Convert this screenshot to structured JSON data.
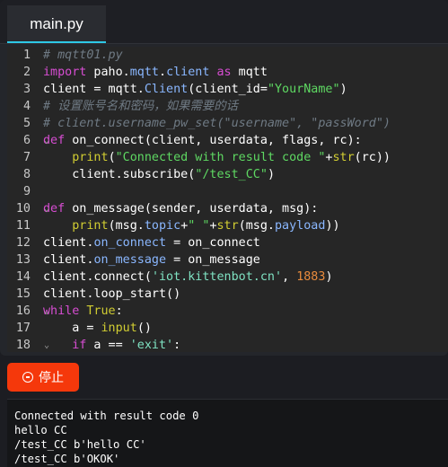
{
  "tab": {
    "label": "main.py"
  },
  "code_lines": [
    {
      "n": "1",
      "fold": "",
      "tokens": [
        [
          "c-com",
          "# mqtt01.py"
        ]
      ]
    },
    {
      "n": "2",
      "fold": "",
      "tokens": [
        [
          "c-kw",
          "import"
        ],
        [
          "txt",
          " paho."
        ],
        [
          "c-attr",
          "mqtt"
        ],
        [
          "txt",
          "."
        ],
        [
          "c-attr",
          "client"
        ],
        [
          "txt",
          " "
        ],
        [
          "c-kw",
          "as"
        ],
        [
          "txt",
          " mqtt"
        ]
      ]
    },
    {
      "n": "3",
      "fold": "",
      "tokens": [
        [
          "txt",
          "client = mqtt."
        ],
        [
          "c-attr",
          "Client"
        ],
        [
          "txt",
          "(client_id="
        ],
        [
          "c-str",
          "\"YourName\""
        ],
        [
          "txt",
          ")"
        ]
      ]
    },
    {
      "n": "4",
      "fold": "",
      "tokens": [
        [
          "c-com",
          "# 设置账号名和密码，如果需要的话"
        ]
      ]
    },
    {
      "n": "5",
      "fold": "",
      "tokens": [
        [
          "c-com",
          "# client.username_pw_set(\"username\", \"passWord\")"
        ]
      ]
    },
    {
      "n": "6",
      "fold": "⌄",
      "tokens": [
        [
          "c-kw",
          "def"
        ],
        [
          "txt",
          " on_connect(client, userdata, flags, rc):"
        ]
      ]
    },
    {
      "n": "7",
      "fold": "",
      "tokens": [
        [
          "txt",
          "    "
        ],
        [
          "c-bi",
          "print"
        ],
        [
          "txt",
          "("
        ],
        [
          "c-str",
          "\"Connected with result code \""
        ],
        [
          "txt",
          "+"
        ],
        [
          "c-bi",
          "str"
        ],
        [
          "txt",
          "(rc))"
        ]
      ]
    },
    {
      "n": "8",
      "fold": "",
      "tokens": [
        [
          "txt",
          "    client.subscribe("
        ],
        [
          "c-str",
          "\"/test_CC\""
        ],
        [
          "txt",
          ")"
        ]
      ]
    },
    {
      "n": "9",
      "fold": "",
      "tokens": []
    },
    {
      "n": "10",
      "fold": "⌄",
      "tokens": [
        [
          "c-kw",
          "def"
        ],
        [
          "txt",
          " on_message(sender, userdata, msg):"
        ]
      ]
    },
    {
      "n": "11",
      "fold": "",
      "tokens": [
        [
          "txt",
          "    "
        ],
        [
          "c-bi",
          "print"
        ],
        [
          "txt",
          "(msg."
        ],
        [
          "c-attr",
          "topic"
        ],
        [
          "txt",
          "+"
        ],
        [
          "c-str",
          "\" \""
        ],
        [
          "txt",
          "+"
        ],
        [
          "c-bi",
          "str"
        ],
        [
          "txt",
          "(msg."
        ],
        [
          "c-attr",
          "payload"
        ],
        [
          "txt",
          "))"
        ]
      ]
    },
    {
      "n": "12",
      "fold": "",
      "tokens": [
        [
          "txt",
          "client."
        ],
        [
          "c-attr",
          "on_connect"
        ],
        [
          "txt",
          " = on_connect"
        ]
      ]
    },
    {
      "n": "13",
      "fold": "",
      "tokens": [
        [
          "txt",
          "client."
        ],
        [
          "c-attr",
          "on_message"
        ],
        [
          "txt",
          " = on_message"
        ]
      ]
    },
    {
      "n": "14",
      "fold": "",
      "tokens": [
        [
          "txt",
          "client.connect("
        ],
        [
          "c-str2",
          "'iot.kittenbot.cn'"
        ],
        [
          "txt",
          ", "
        ],
        [
          "c-num",
          "1883"
        ],
        [
          "txt",
          ")"
        ]
      ]
    },
    {
      "n": "15",
      "fold": "",
      "tokens": [
        [
          "txt",
          "client.loop_start()"
        ]
      ]
    },
    {
      "n": "16",
      "fold": "⌄",
      "tokens": [
        [
          "c-kw",
          "while"
        ],
        [
          "txt",
          " "
        ],
        [
          "c-bi",
          "True"
        ],
        [
          "txt",
          ":"
        ]
      ]
    },
    {
      "n": "17",
      "fold": "",
      "tokens": [
        [
          "txt",
          "    a = "
        ],
        [
          "c-bi",
          "input"
        ],
        [
          "txt",
          "()"
        ]
      ]
    },
    {
      "n": "18",
      "fold": "⌄",
      "tokens": [
        [
          "txt",
          "    "
        ],
        [
          "c-kw",
          "if"
        ],
        [
          "txt",
          " a == "
        ],
        [
          "c-str2",
          "'exit'"
        ],
        [
          "txt",
          ":"
        ]
      ]
    }
  ],
  "stop_button": {
    "label": "停止",
    "icon": "minus-circle-icon",
    "color": "#f5380b"
  },
  "console": {
    "lines": [
      "Connected with result code 0",
      "hello CC",
      "/test_CC b'hello CC'",
      "/test_CC b'OKOK'"
    ]
  },
  "colors": {
    "accent": "#2ec9e6",
    "stop": "#f5380b"
  }
}
